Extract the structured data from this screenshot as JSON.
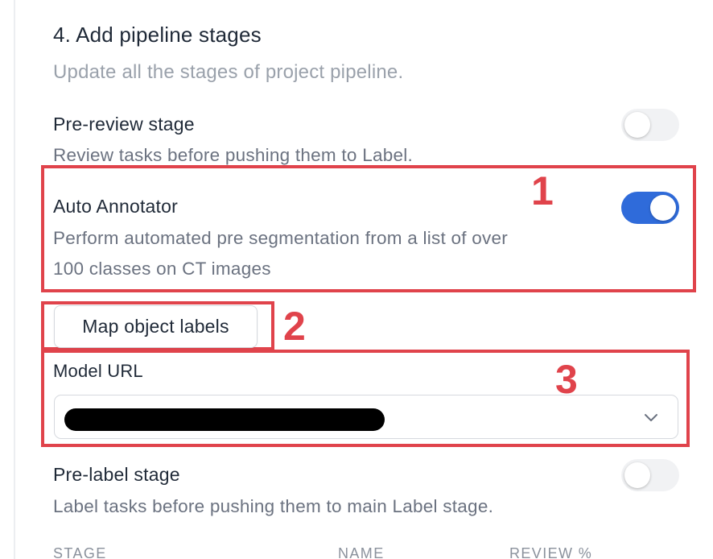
{
  "section": {
    "title": "4. Add pipeline stages",
    "subtitle": "Update all the stages of project pipeline."
  },
  "stages": {
    "pre_review": {
      "title": "Pre-review stage",
      "description": "Review tasks before pushing them to Label.",
      "enabled": false
    },
    "auto_annotator": {
      "title": "Auto Annotator",
      "description_line1": "Perform automated pre segmentation from a list of over",
      "description_line2": "100 classes on CT images",
      "enabled": true
    },
    "pre_label": {
      "title": "Pre-label stage",
      "description": "Label tasks before pushing them to main Label stage.",
      "enabled": false
    }
  },
  "map_labels_button": "Map object labels",
  "model_url": {
    "label": "Model URL",
    "value_redacted": true,
    "icon": "chevron-down-icon"
  },
  "table": {
    "headers": [
      "STAGE",
      "NAME",
      "REVIEW %"
    ]
  },
  "annotations": [
    "1",
    "2",
    "3"
  ],
  "colors": {
    "toggle_on": "#2f6bda",
    "toggle_off": "#f1f2f4",
    "annotation": "#e0434b",
    "text_primary": "#1f2937",
    "text_secondary": "#6b7280",
    "text_muted": "#9aa1ab"
  }
}
